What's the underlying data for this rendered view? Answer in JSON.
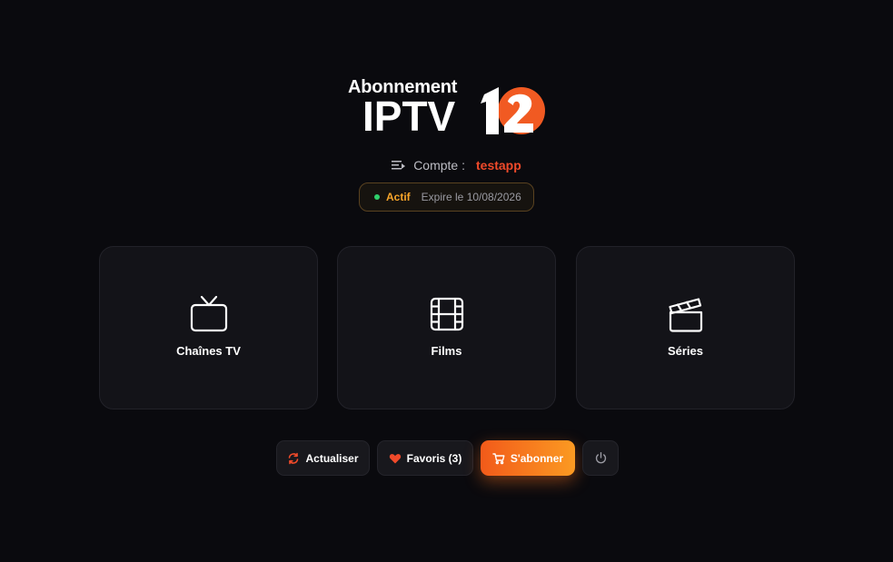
{
  "logo": {
    "top_text": "Abonnement",
    "main_text": "IPTV",
    "badge_number": "12"
  },
  "account": {
    "label": "Compte :",
    "username": "testapp"
  },
  "status": {
    "state": "Actif",
    "expiry": "Expire le 10/08/2026"
  },
  "cards": [
    {
      "label": "Chaînes TV",
      "icon": "tv-icon"
    },
    {
      "label": "Films",
      "icon": "film-icon"
    },
    {
      "label": "Séries",
      "icon": "clapperboard-icon"
    }
  ],
  "actions": {
    "refresh_label": "Actualiser",
    "favorites_label": "Favoris (3)",
    "subscribe_label": "S'abonner",
    "power_icon": "power-icon"
  },
  "colors": {
    "background": "#0a0a0e",
    "card": "#131318",
    "accent_red": "#f04a2a",
    "accent_orange": "#fb9a22",
    "status_green": "#2fcf6b"
  }
}
